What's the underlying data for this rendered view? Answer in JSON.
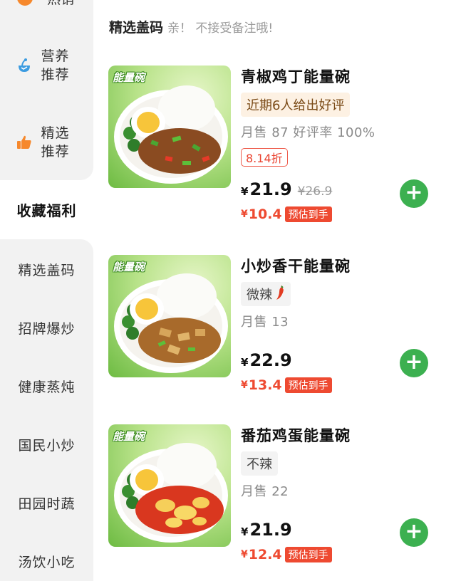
{
  "sidebar": {
    "items": [
      {
        "label": "热销",
        "partial": true
      },
      {
        "label_line1": "营养",
        "label_line2": "推荐",
        "icon": "nutrition-icon"
      },
      {
        "label_line1": "精选",
        "label_line2": "推荐",
        "icon": "thumbs-up-icon"
      },
      {
        "label": "收藏福利",
        "active": true
      },
      {
        "label": "精选盖码"
      },
      {
        "label": "招牌爆炒"
      },
      {
        "label": "健康蒸炖"
      },
      {
        "label": "国民小炒"
      },
      {
        "label": "田园时蔬"
      },
      {
        "label": "汤饮小吃"
      }
    ]
  },
  "section": {
    "title": "精选盖码",
    "subtitle": "亲！ 不接受备注哦!"
  },
  "products": [
    {
      "brand": "能量碗",
      "name": "青椒鸡丁能量碗",
      "tag": "近期6人给出好评",
      "sales": "月售 87  好评率 100%",
      "discount": "8.14折",
      "currency": "¥",
      "price": "21.9",
      "original_price": "¥26.9",
      "est_price": "10.4",
      "est_label": "预估到手"
    },
    {
      "brand": "能量碗",
      "name": "小炒香干能量碗",
      "tag": "微辣",
      "tag_icon": "chili-icon",
      "sales": "月售 13",
      "currency": "¥",
      "price": "22.9",
      "est_price": "13.4",
      "est_label": "预估到手"
    },
    {
      "brand": "能量碗",
      "name": "番茄鸡蛋能量碗",
      "tag": "不辣",
      "sales": "月售 22",
      "currency": "¥",
      "price": "21.9",
      "est_price": "12.4",
      "est_label": "预估到手"
    }
  ],
  "colors": {
    "accent_green": "#3cb050",
    "price_red": "#ee4a31",
    "sidebar_bg": "#f2f2f2"
  }
}
